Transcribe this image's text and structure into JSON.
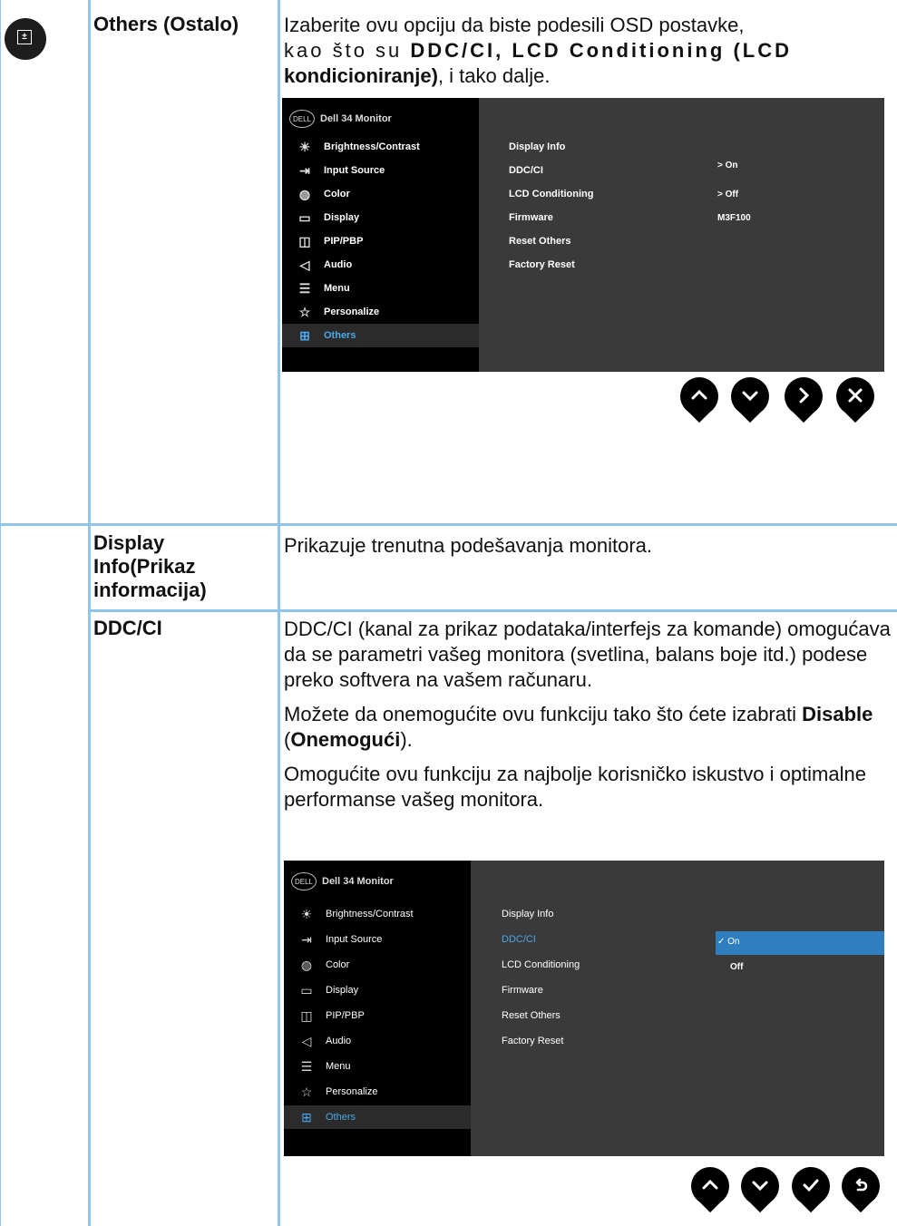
{
  "rows": [
    {
      "title": "Others (Ostalo)",
      "desc_intro": "Izaberite ovu opciju da biste podesili OSD postavke,",
      "desc_mid1": "kao što su ",
      "desc_b1": "DDC/CI, LCD Conditioning (LCD",
      "desc_b2": "kondicioniranje)",
      "desc_end": ", i tako dalje."
    },
    {
      "title_line1": "Display",
      "title_line2": "Info(Prikaz",
      "title_line3": "informacija)",
      "desc": "Prikazuje trenutna podešavanja monitora."
    },
    {
      "title": "DDC/CI",
      "p1": "DDC/CI (kanal za prikaz podataka/interfejs za komande) omogućava da se parametri vašeg monitora (svetlina, balans boje itd.) podese preko softvera na vašem računaru.",
      "p2_start": "Možete da onemogućite ovu funkciju tako što ćete izabrati ",
      "p2_b1": "Disable",
      "p2_mid": " (",
      "p2_b2": "Onemogući",
      "p2_end": ").",
      "p3": "Omogućite ovu funkciju za najbolje korisničko iskustvo i optimalne performanse vašeg monitora."
    }
  ],
  "osd": {
    "logo": "DELL",
    "brand": "Dell 34 Monitor",
    "menu": [
      "Brightness/Contrast",
      "Input Source",
      "Color",
      "Display",
      "PIP/PBP",
      "Audio",
      "Menu",
      "Personalize",
      "Others"
    ],
    "options": [
      "Display Info",
      "DDC/CI",
      "LCD Conditioning",
      "Firmware",
      "Reset Others",
      "Factory Reset"
    ],
    "values1": {
      "ddcci": "> On",
      "lcd": "> Off",
      "firmware": "M3F100"
    },
    "values2": {
      "on": "✓ On",
      "off": "Off"
    }
  },
  "icons": [
    "others-icon",
    "brightness-icon",
    "input-source-icon",
    "color-icon",
    "display-icon",
    "pip-pbp-icon",
    "audio-icon",
    "menu-icon",
    "personalize-icon"
  ],
  "colors": {
    "grid": "#8fc6ea",
    "osd_bg": "#3a3a3a",
    "osd_side": "#000000",
    "accent": "#4aa7e8",
    "selection": "#2f7fbf"
  }
}
